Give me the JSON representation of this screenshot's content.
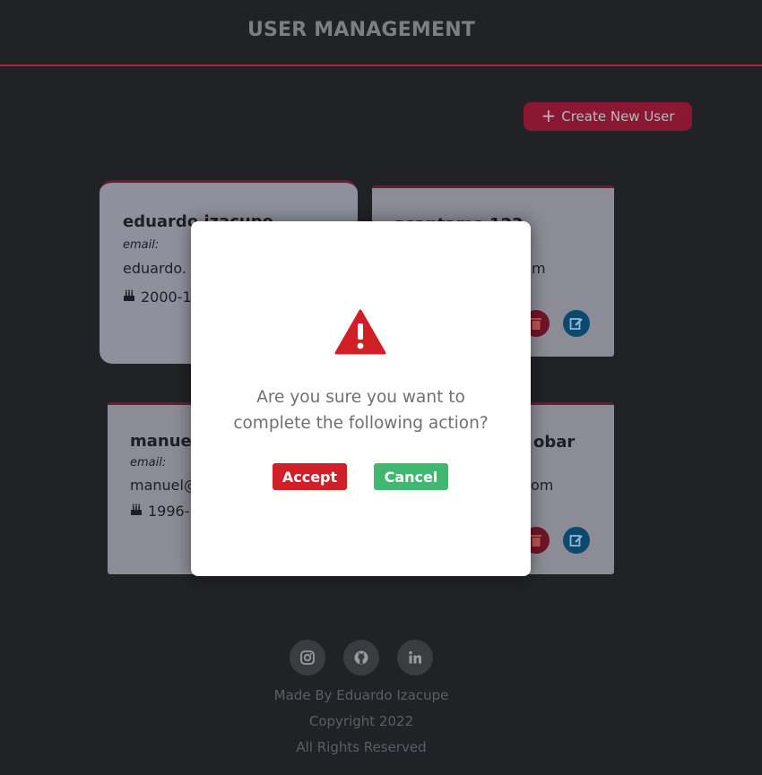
{
  "header": {
    "title": "USER MANAGEMENT"
  },
  "toolbar": {
    "create_label": "Create New User",
    "create_icon": "plus-icon"
  },
  "users": [
    {
      "name": "eduardo izacupe",
      "email_label": "email:",
      "email_partial": "eduardo.",
      "birthday_partial": "2000-1"
    },
    {
      "name_partial": "asantamo 123",
      "email_tail": "m"
    },
    {
      "name_partial": "manuel",
      "email_label": "email:",
      "email_partial": "manuel@",
      "birthday_partial": "1996-1"
    },
    {
      "name_tail": "obar",
      "email_tail": "om"
    }
  ],
  "modal": {
    "icon": "warning-icon",
    "question_line1": "Are you sure you want to",
    "question_line2": "complete the following action?",
    "accept_label": "Accept",
    "cancel_label": "Cancel"
  },
  "footer": {
    "social": [
      "instagram-icon",
      "github-icon",
      "linkedin-icon"
    ],
    "made_by": "Made By Eduardo Izacupe",
    "copyright": "Copyright 2022",
    "rights": "All Rights Reserved"
  },
  "colors": {
    "accent": "#b3203f",
    "accept": "#d01f26",
    "cancel": "#41b870",
    "warning": "#d01f26",
    "edit": "#0b4a6e"
  }
}
